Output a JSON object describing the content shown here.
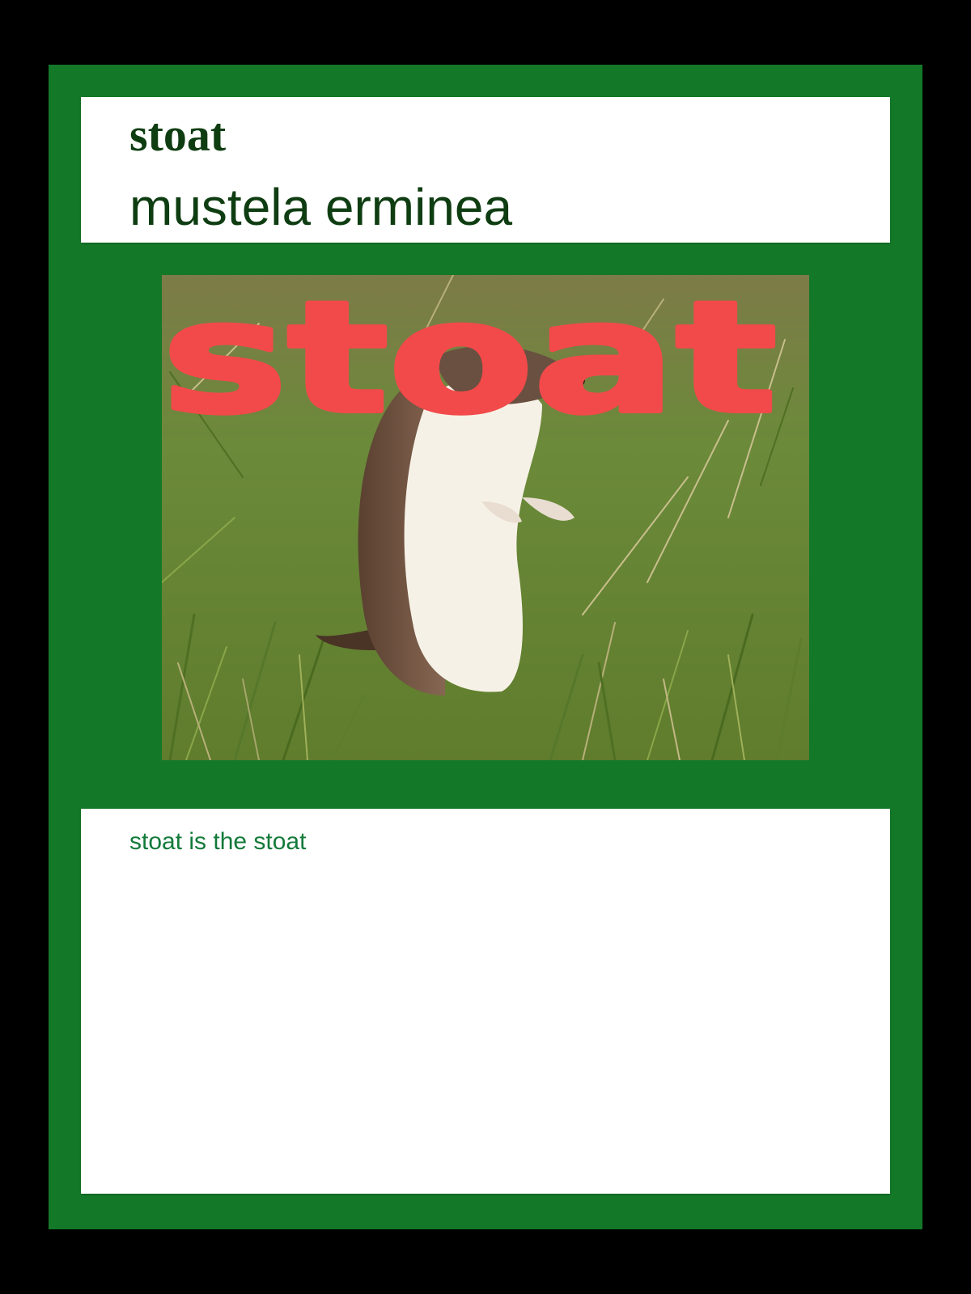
{
  "card": {
    "common_name": "stoat",
    "latin_name": "mustela erminea",
    "photo_overlay_text": "stoat",
    "description": "stoat is the stoat"
  },
  "colors": {
    "page_background": "#000000",
    "card_border": "#137828",
    "panel_background": "#ffffff",
    "title_text": "#0f3d12",
    "description_text": "#137a3a",
    "overlay_text": "#f24a4a"
  },
  "icons": {
    "photo": "stoat-photo"
  }
}
